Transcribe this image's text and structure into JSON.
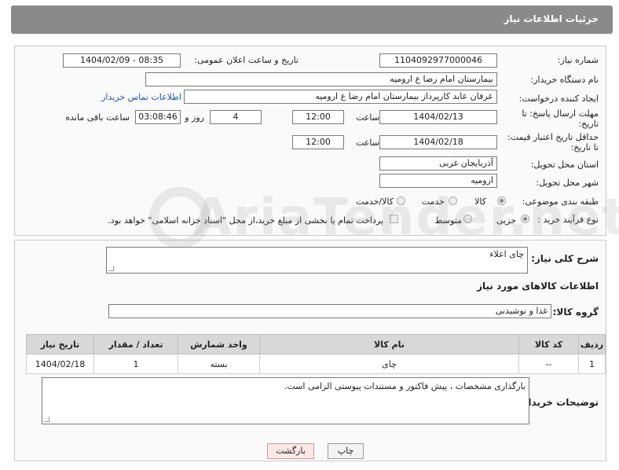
{
  "header": {
    "title": "جزئیات اطلاعات نیاز"
  },
  "form": {
    "need_number_label": "شماره نیاز:",
    "need_number": "1104092977000046",
    "announce_label": "تاریخ و ساعت اعلان عمومی:",
    "announce_value": "1404/02/09 - 08:35",
    "buyer_label": "نام دستگاه خریدار:",
    "buyer_value": "بیمارستان امام رضا  ع  ارومیه",
    "requester_label": "ایجاد کننده درخواست:",
    "requester_value": "عرفان عابد کارپرداز بیمارستان امام رضا  ع  ارومیه",
    "contact_link": "اطلاعات تماس خریدار",
    "deadline_label": "مهلت ارسال پاسخ: تا تاریخ:",
    "deadline_date": "1404/02/13",
    "time_label": "ساعت",
    "deadline_time": "12:00",
    "days_value": "4",
    "days_label": "روز و",
    "remaining_value": "03:08:46",
    "remaining_label": "ساعت باقی مانده",
    "validity_label": "حداقل تاریخ اعتبار قیمت: تا تاریخ:",
    "validity_date": "1404/02/18",
    "validity_time": "12:00",
    "province_label": "استان محل تحویل:",
    "province_value": "آذربایجان غربی",
    "city_label": "شهر محل تحویل:",
    "city_value": "ارومیه",
    "category_label": "طبقه بندی موضوعی:",
    "category_options": [
      "کالا",
      "خدمت",
      "کالا/خدمت"
    ],
    "category_selected": "کالا",
    "process_label": "نوع فرآیند خرید :",
    "process_options": [
      "جزیی",
      "متوسط"
    ],
    "process_selected": "جزیی",
    "payment_note": "پرداخت تمام یا بخشی از مبلغ خرید،از محل \"اسناد خزانه اسلامی\" خواهد بود."
  },
  "watermark": "AriaTender.net",
  "details": {
    "summary_label": "شرح کلی نیاز:",
    "summary_value": "چای اعلاء",
    "goods_info_title": "اطلاعات کالاهای مورد نیاز",
    "group_label": "گروه کالا:",
    "group_value": "غذا و نوشیدنی",
    "table": {
      "headers": [
        "ردیف",
        "کد کالا",
        "نام کالا",
        "واحد شمارش",
        "تعداد / مقدار",
        "تاریخ نیاز"
      ],
      "rows": [
        [
          "1",
          "--",
          "چای",
          "بسته",
          "1",
          "1404/02/18"
        ]
      ]
    },
    "buyer_notes_label": "توضیحات خریدار:",
    "buyer_notes_value": "بارگذاری مشخصات ، پیش فاکتور و مستندات پیوستی الزامی است."
  },
  "buttons": {
    "print": "چاپ",
    "back": "بازگشت"
  }
}
